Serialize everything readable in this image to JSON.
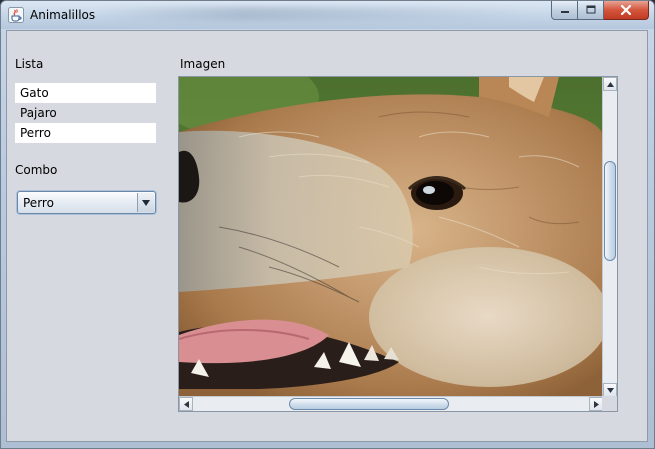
{
  "window": {
    "title": "Animalillos",
    "icon": "java-cup-icon"
  },
  "caption_buttons": [
    "minimize-icon",
    "maximize-icon",
    "close-icon"
  ],
  "lista": {
    "label": "Lista",
    "items": [
      "Gato",
      "Pajaro",
      "Perro"
    ]
  },
  "combo": {
    "label": "Combo",
    "selected": "Perro",
    "icon": "dropdown-arrow-icon"
  },
  "imagen": {
    "label": "Imagen",
    "subject": "dog close-up photo"
  },
  "colors": {
    "client_bg": "#d6d9df",
    "list_item_bg": "#ffffff",
    "close_button": "#c8452e",
    "titlebar": "#c2d3e6"
  }
}
